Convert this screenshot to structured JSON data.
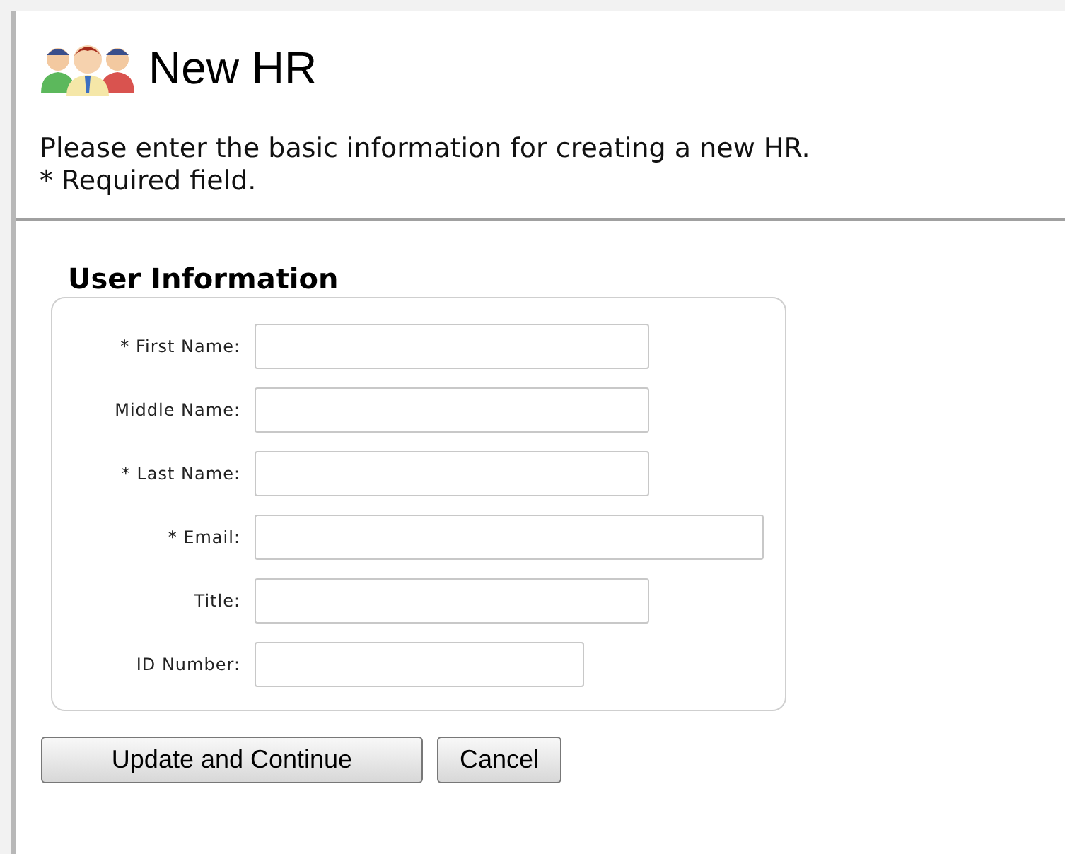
{
  "header": {
    "title": "New HR",
    "description": "Please enter the basic information for creating a new HR.",
    "note": "* Required field."
  },
  "section": {
    "title": "User Information",
    "fields": [
      {
        "label": "* First Name:",
        "kind": "medium"
      },
      {
        "label": "Middle Name:",
        "kind": "medium"
      },
      {
        "label": "* Last Name:",
        "kind": "medium"
      },
      {
        "label": "* Email:",
        "kind": "long"
      },
      {
        "label": "Title:",
        "kind": "medium"
      },
      {
        "label": "ID Number:",
        "kind": "short"
      }
    ]
  },
  "buttons": [
    "Update and Continue",
    "Cancel"
  ]
}
